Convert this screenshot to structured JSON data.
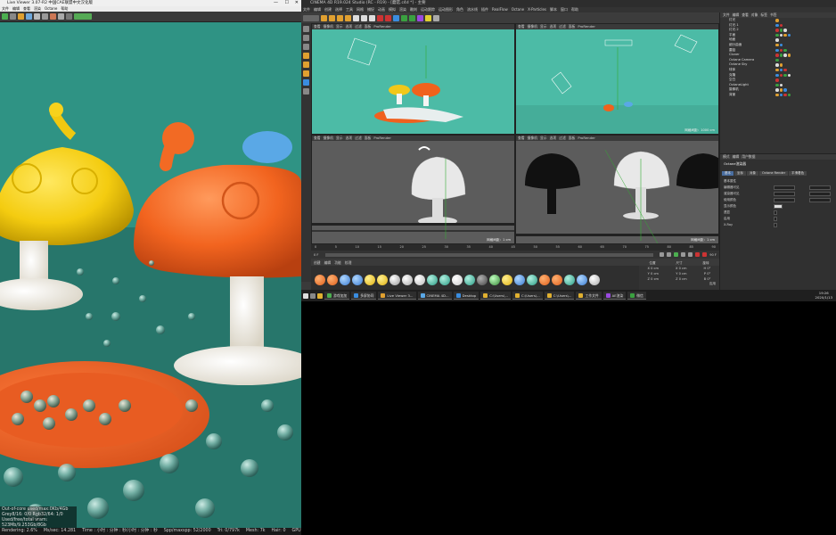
{
  "live_viewer": {
    "title": "Live Viewer 3.07-R2 中国CAE联盟中文汉化版",
    "menu": [
      "文件",
      "编辑",
      "查看",
      "渲染",
      "Octane",
      "帮助"
    ],
    "stats": [
      "Out-of-core used/max:0Kb/4Gb",
      "Grey8/16: 0/0        Rgb32/64: 1/0",
      "Used/free/total vram: 523Mb/9.253Gb/8Gb"
    ],
    "status": {
      "rendering": "Rendering: 2.6%",
      "mss": "Ms/sec: 14.281",
      "time": "Time : 小时 : 分钟 : 秒/小时 : 分钟 : 秒",
      "spp": "Spp/maxspp: 52/2000",
      "tri": "Tri: 0/797k",
      "mesh": "Mesh: 7k",
      "hair": "Hair: 0",
      "gpu": "GPU: 67°C"
    }
  },
  "c4d": {
    "title": "CINEMA 4D R19.024 Studio (RC - R19) - [蘑菇.c4d *] - 主要",
    "menu": [
      "文件",
      "编辑",
      "创建",
      "选择",
      "工具",
      "网格",
      "捕捉",
      "动画",
      "模拟",
      "渲染",
      "雕刻",
      "运动跟踪",
      "运动图形",
      "角色",
      "流水线",
      "插件",
      "RealFlow",
      "Octane",
      "X-Particles",
      "脚本",
      "窗口",
      "帮助"
    ],
    "viewports": [
      {
        "label": "透视视图",
        "menu": [
          "查看",
          "摄像机",
          "显示",
          "选项",
          "过滤",
          "面板",
          "ProRender"
        ],
        "info": ""
      },
      {
        "label": "顶视图",
        "menu": [
          "查看",
          "摄像机",
          "显示",
          "选项",
          "过滤",
          "面板",
          "ProRender"
        ],
        "info": "网格间距：1000 cm"
      },
      {
        "label": "右视图",
        "menu": [
          "查看",
          "摄像机",
          "显示",
          "选项",
          "过滤",
          "面板",
          "ProRender"
        ],
        "info": "网格间距：1 cm"
      },
      {
        "label": "正视图",
        "menu": [
          "查看",
          "摄像机",
          "显示",
          "选项",
          "过滤",
          "面板",
          "ProRender"
        ],
        "info": "网格间距：1 cm"
      }
    ],
    "timeline_ticks": [
      "0",
      "5",
      "10",
      "15",
      "20",
      "25",
      "30",
      "35",
      "40",
      "45",
      "50",
      "55",
      "60",
      "65",
      "70",
      "75",
      "80",
      "85",
      "90"
    ],
    "frame_start": "0 F",
    "frame_end": "90 F",
    "material_menu": [
      "创建",
      "编辑",
      "功能",
      "纹理"
    ],
    "coords": {
      "headers": [
        "位置",
        "尺寸",
        "旋转"
      ],
      "rows": [
        [
          "X 0 cm",
          "X 0 cm",
          "H 0°"
        ],
        [
          "Y 0 cm",
          "Y 0 cm",
          "P 0°"
        ],
        [
          "Z 0 cm",
          "Z 0 cm",
          "B 0°"
        ]
      ],
      "apply": "应用"
    },
    "object_manager": {
      "menu": [
        "文件",
        "编辑",
        "查看",
        "对象",
        "标签",
        "书签"
      ],
      "items": [
        "灯光",
        "灯光.1",
        "灯光.2",
        "平面",
        "地面",
        "细分曲面",
        "蘑菇",
        "Cloner",
        "Octane Camera",
        "Octane Sky",
        "球体",
        "克隆",
        "空白",
        "OctaneLight",
        "摄像机",
        "背景"
      ]
    },
    "attributes": {
      "menu": [
        "模式",
        "编辑",
        "用户数据"
      ],
      "title": "Octane渲染器",
      "tabs": [
        "基本",
        "坐标",
        "对象",
        "Octane Render",
        "平滑着色"
      ],
      "rows": [
        "基本属性",
        "编辑器可见",
        "渲染器可见",
        "使用颜色",
        "显示颜色",
        "透显",
        "启用",
        "X-Ray"
      ]
    }
  },
  "taskbar": {
    "tasks": [
      "游戏加加",
      "多屏协同",
      "Live Viewer 3...",
      "CINEMA 4D...",
      "Desktop",
      "C:\\Users\\...",
      "C:\\Users\\...",
      "C:\\Users\\...",
      "工作文件",
      "AE渲染",
      "微信"
    ],
    "time": "19:26",
    "date": "2020/1/13"
  }
}
